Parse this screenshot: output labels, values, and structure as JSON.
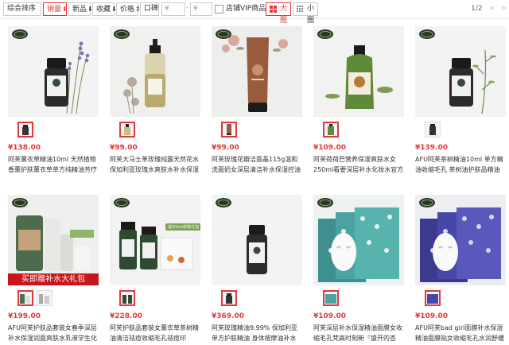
{
  "toolbar": {
    "sort_overall": "综合排序",
    "sort_sales": "销量",
    "sort_new": "新品",
    "sort_fav": "收藏",
    "sort_price": "价格",
    "sort_reviews": "口碑",
    "price_min_placeholder": "¥",
    "price_max_placeholder": "¥",
    "price_dash": "-",
    "vip_label": "店铺VIP商品",
    "view_large": "大图",
    "view_small": "小图",
    "page_info": "1/2",
    "prev": "<",
    "next": ">"
  },
  "colors": {
    "accent": "#e4393c",
    "banner": "#c8161d"
  },
  "products": [
    {
      "price": "¥138.00",
      "title": "阿芙薰衣草精油10ml 天然植物香薰护肤薰衣草单方纯精油芳疗正品"
    },
    {
      "price": "¥99.00",
      "title": "阿芙大马士革玫瑰纯露天然花水保加利亚玫瑰水爽肤水补水保湿喷雾"
    },
    {
      "price": "¥99.00",
      "title": "阿芙玫瑰花瓣洁面晶115g温和洗面奶女深层清洁补水保湿控油洁面"
    },
    {
      "price": "¥109.00",
      "title": "阿芙荷荷巴营养保湿爽肤水女250ml看要深层补水化妆水官方旗"
    },
    {
      "price": "¥139.00",
      "title": "AFU阿芙茶树精油10ml 单方精油收缩毛孔 茶树油护肤品精油"
    },
    {
      "price": "¥199.00",
      "title": "AFU阿芙护肤品套装女春季深层补水保湿润面爽肤水乳液学生化妆品",
      "banner": "买即赠补水大礼包"
    },
    {
      "price": "¥228.00",
      "title": "阿芙护肤品套装女薰衣草茶树精油清洁祛痘收缩毛孔祛痘印",
      "tag": "送4/1ml护肤礼包"
    },
    {
      "price": "¥369.00",
      "title": "阿芙玫瑰精油9.99% 保加利亚单方护肤精油 身体按摩油补水保湿"
    },
    {
      "price": "¥109.00",
      "title": "阿芙深层补水保湿精油面膜女收缩毛孔梵高时刻新『盛开的杏花』"
    },
    {
      "price": "¥109.00",
      "title": "AFU阿芙bad girl面膜补水保湿精油面膜贴女收缩毛孔水润舒缓面膜"
    }
  ]
}
